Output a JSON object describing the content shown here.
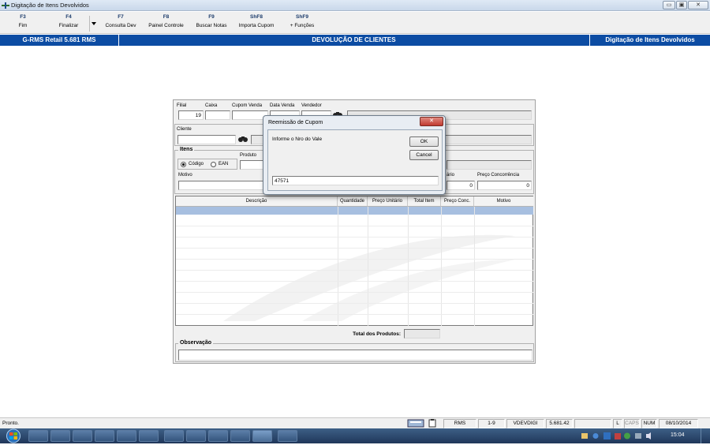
{
  "window": {
    "title": "Digitação de Itens Devolvidos",
    "controls": [
      "▭",
      "▣",
      "✕"
    ]
  },
  "toolbar": [
    {
      "key": "F3",
      "label": "Fim"
    },
    {
      "key": "F4",
      "label": "Finalizar"
    },
    {
      "key": "F7",
      "label": "Consulta Dev"
    },
    {
      "key": "F8",
      "label": "Painel Controle"
    },
    {
      "key": "F9",
      "label": "Buscar Notas"
    },
    {
      "key": "ShF8",
      "label": "Importa Cupom"
    },
    {
      "key": "ShF9",
      "label": "+ Funções"
    }
  ],
  "header": {
    "system": "G-RMS Retail 5.681 RMS",
    "title": "DEVOLUÇÃO DE CLIENTES",
    "screen": "Digitação de Itens Devolvidos"
  },
  "form": {
    "filial_label": "Filial",
    "filial_value": "19",
    "caixa_label": "Caixa",
    "cupom_label": "Cupom Venda",
    "data_label": "Data Venda",
    "vendedor_label": "Vendedor",
    "cliente_label": "Cliente",
    "itens_label": "Itens",
    "codigo_label": "Código",
    "ean_label": "EAN",
    "produto_label": "Produto",
    "unitario_label": "ário",
    "motivo_label": "Motivo",
    "preco_conc_label": "Preço Concorrência",
    "unitario_value": "0",
    "preco_conc_value": "0"
  },
  "grid": {
    "columns": [
      "Descrição",
      "Quantidade",
      "Preço Unitário",
      "Total Item",
      "Preço Conc.",
      "Motivo"
    ]
  },
  "totals": {
    "label": "Total dos Produtos:"
  },
  "observacao": {
    "label": "Observação"
  },
  "dialog": {
    "title": "Reemissão de Cupom",
    "prompt": "Informe o Nro do Vale",
    "ok": "OK",
    "cancel": "Cancel",
    "value": "47571",
    "close": "✕"
  },
  "status": {
    "text": "Pronto.",
    "fields": [
      "RMS",
      "1-9",
      "VDEVDIGI",
      "5.681.42",
      "",
      "L",
      "CAPS",
      "NUM",
      "08/10/2014"
    ]
  },
  "taskbar": {
    "time": "15:04"
  },
  "colors": {
    "header_blue": "#0c4ca3",
    "selection": "#a7bfe0",
    "dialog_close": "#c9403a"
  }
}
